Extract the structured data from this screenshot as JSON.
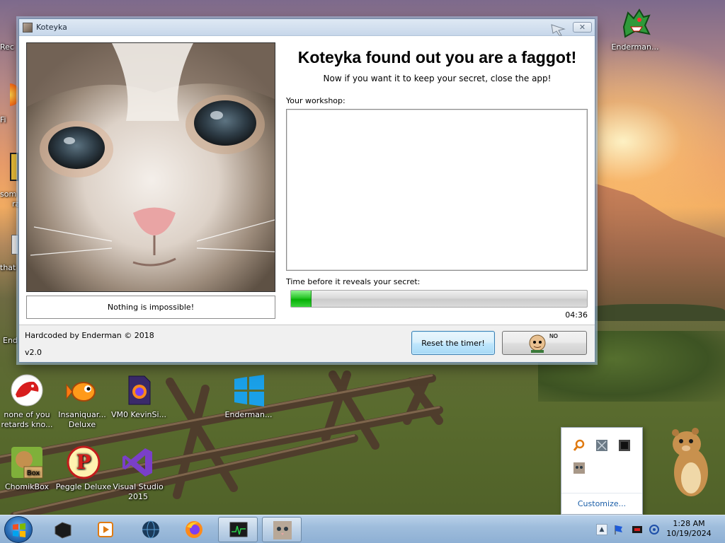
{
  "desktop": {
    "edge_labels": [
      "Rec",
      "Fi",
      "som",
      "ra",
      "that",
      "End"
    ],
    "icons_top": [
      {
        "label": "Enderman...",
        "name": "enderman-dragon"
      }
    ],
    "icons_bottom": [
      {
        "label": "none of you retards kno...",
        "name": "red-dragon"
      },
      {
        "label": "Insaniquar... Deluxe",
        "name": "insaniquarium"
      },
      {
        "label": "VM0 KevinSi...",
        "name": "vm0-firefox-file"
      },
      {
        "label": "Enderman...",
        "name": "windows-logo"
      },
      {
        "label": "ChomikBox",
        "name": "chomikbox"
      },
      {
        "label": "Peggle Deluxe",
        "name": "peggle"
      },
      {
        "label": "Visual Studio 2015",
        "name": "visual-studio"
      }
    ]
  },
  "window": {
    "title": "Koteyka",
    "close_glyph": "✕",
    "headline": "Koteyka found out you are a faggot!",
    "subline": "Now if you want it to keep your secret, close the app!",
    "caption": "Nothing is impossible!",
    "workshop_label": "Your workshop:",
    "workshop_value": "",
    "timer_label": "Time before it reveals your secret:",
    "timer_progress_percent": 7,
    "countdown": "04:36",
    "credit": "Hardcoded by Enderman © 2018",
    "version": "v2.0",
    "reset_button": "Reset the timer!",
    "baldi_button_text": "NO"
  },
  "tray_flyout": {
    "icons": [
      "magnifier-icon",
      "network-grid-icon",
      "black-square-icon",
      "cat-photo-icon"
    ],
    "customize": "Customize..."
  },
  "taskbar": {
    "apps": [
      "black-cube-app",
      "media-player-app",
      "globe-app",
      "firefox-app",
      "monitor-app",
      "koteyka-app"
    ],
    "time": "1:28 AM",
    "date": "10/19/2024",
    "tray_up_glyph": "▲"
  },
  "colors": {
    "progress_green": "#06b006",
    "link_blue": "#1a5ea8",
    "button_focus_border": "#3c7fb1"
  }
}
